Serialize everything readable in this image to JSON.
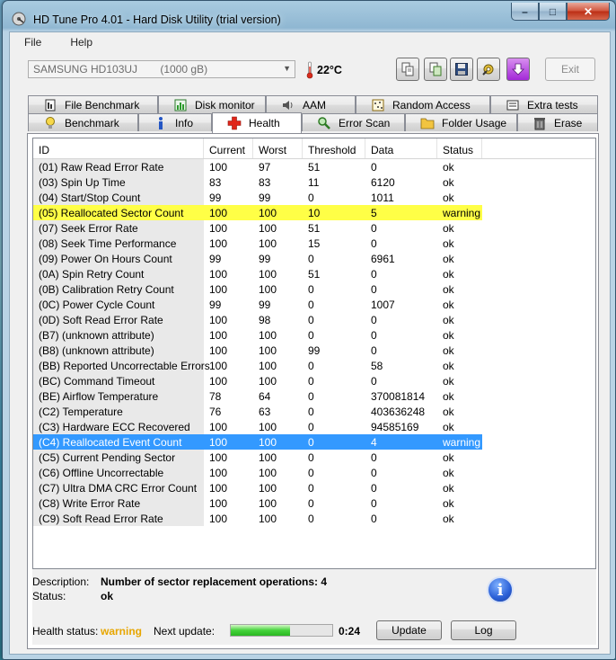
{
  "window": {
    "title": "HD Tune Pro 4.01 - Hard Disk Utility (trial version)"
  },
  "menu": {
    "file": "File",
    "help": "Help"
  },
  "toolbar": {
    "drive": "SAMSUNG HD103UJ",
    "capacity": "(1000 gB)",
    "temperature": "22°C",
    "exit_label": "Exit"
  },
  "tabs": {
    "row1": [
      {
        "label": "File Benchmark",
        "icon": "file-benchmark-icon"
      },
      {
        "label": "Disk monitor",
        "icon": "disk-monitor-icon"
      },
      {
        "label": "AAM",
        "icon": "speaker-icon"
      },
      {
        "label": "Random Access",
        "icon": "random-access-icon"
      },
      {
        "label": "Extra tests",
        "icon": "extra-tests-icon"
      }
    ],
    "row2": [
      {
        "label": "Benchmark",
        "icon": "lightbulb-icon"
      },
      {
        "label": "Info",
        "icon": "info-icon"
      },
      {
        "label": "Health",
        "icon": "health-cross-icon"
      },
      {
        "label": "Error Scan",
        "icon": "magnifier-icon"
      },
      {
        "label": "Folder Usage",
        "icon": "folder-icon"
      },
      {
        "label": "Erase",
        "icon": "trash-icon"
      }
    ],
    "active": "Health"
  },
  "grid": {
    "headers": [
      "ID",
      "Current",
      "Worst",
      "Threshold",
      "Data",
      "Status"
    ],
    "rows": [
      [
        "(01) Raw Read Error Rate",
        "100",
        "97",
        "51",
        "0",
        "ok"
      ],
      [
        "(03) Spin Up Time",
        "83",
        "83",
        "11",
        "6120",
        "ok"
      ],
      [
        "(04) Start/Stop Count",
        "99",
        "99",
        "0",
        "1011",
        "ok"
      ],
      [
        "(05) Reallocated Sector Count",
        "100",
        "100",
        "10",
        "5",
        "warning"
      ],
      [
        "(07) Seek Error Rate",
        "100",
        "100",
        "51",
        "0",
        "ok"
      ],
      [
        "(08) Seek Time Performance",
        "100",
        "100",
        "15",
        "0",
        "ok"
      ],
      [
        "(09) Power On Hours Count",
        "99",
        "99",
        "0",
        "6961",
        "ok"
      ],
      [
        "(0A) Spin Retry Count",
        "100",
        "100",
        "51",
        "0",
        "ok"
      ],
      [
        "(0B) Calibration Retry Count",
        "100",
        "100",
        "0",
        "0",
        "ok"
      ],
      [
        "(0C) Power Cycle Count",
        "99",
        "99",
        "0",
        "1007",
        "ok"
      ],
      [
        "(0D) Soft Read Error Rate",
        "100",
        "98",
        "0",
        "0",
        "ok"
      ],
      [
        "(B7) (unknown attribute)",
        "100",
        "100",
        "0",
        "0",
        "ok"
      ],
      [
        "(B8) (unknown attribute)",
        "100",
        "100",
        "99",
        "0",
        "ok"
      ],
      [
        "(BB) Reported Uncorrectable Errors",
        "100",
        "100",
        "0",
        "58",
        "ok"
      ],
      [
        "(BC) Command Timeout",
        "100",
        "100",
        "0",
        "0",
        "ok"
      ],
      [
        "(BE) Airflow Temperature",
        "78",
        "64",
        "0",
        "370081814",
        "ok"
      ],
      [
        "(C2) Temperature",
        "76",
        "63",
        "0",
        "403636248",
        "ok"
      ],
      [
        "(C3) Hardware ECC Recovered",
        "100",
        "100",
        "0",
        "94585169",
        "ok"
      ],
      [
        "(C4) Reallocated Event Count",
        "100",
        "100",
        "0",
        "4",
        "warning"
      ],
      [
        "(C5) Current Pending Sector",
        "100",
        "100",
        "0",
        "0",
        "ok"
      ],
      [
        "(C6) Offline Uncorrectable",
        "100",
        "100",
        "0",
        "0",
        "ok"
      ],
      [
        "(C7) Ultra DMA CRC Error Count",
        "100",
        "100",
        "0",
        "0",
        "ok"
      ],
      [
        "(C8) Write Error Rate",
        "100",
        "100",
        "0",
        "0",
        "ok"
      ],
      [
        "(C9) Soft Read Error Rate",
        "100",
        "100",
        "0",
        "0",
        "ok"
      ]
    ],
    "warning_row": 3,
    "selected_row": 18,
    "colors": {
      "warning": "#ffff46",
      "selected": "#3399ff"
    }
  },
  "details": {
    "description_label": "Description:",
    "description_value": "Number of sector replacement operations: 4",
    "status_label": "Status:",
    "status_value": "ok"
  },
  "footer": {
    "health_label": "Health status:",
    "health_value": "warning",
    "health_color": "#e7a600",
    "next_update_label": "Next update:",
    "progress": 0.58,
    "timer": "0:24",
    "update_label": "Update",
    "log_label": "Log"
  }
}
